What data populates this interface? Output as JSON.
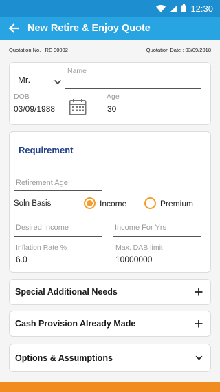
{
  "status": {
    "time": "12:30"
  },
  "appbar": {
    "title": "New Retire & Enjoy Quote"
  },
  "quote": {
    "number_label": "Quotation No. : RE 00002",
    "date_label": "Quotation Date : 03/09/2018"
  },
  "personal": {
    "salutation": "Mr.",
    "name_placeholder": "Name",
    "name_value": "",
    "dob_label": "DOB",
    "dob_value": "03/09/1988",
    "age_label": "Age",
    "age_value": "30"
  },
  "requirement": {
    "title": "Requirement",
    "retirement_age_placeholder": "Retirement Age",
    "soln_basis_label": "Soln Basis",
    "options": [
      {
        "label": "Income",
        "selected": true
      },
      {
        "label": "Premium",
        "selected": false
      }
    ],
    "desired_income_placeholder": "Desired Income",
    "income_for_yrs_placeholder": "Income For Yrs",
    "inflation_label": "Inflation Rate %",
    "inflation_value": "6.0",
    "dab_label": "Max. DAB limit",
    "dab_value": "10000000"
  },
  "sections": [
    {
      "label": "Special Additional Needs",
      "icon": "plus-icon"
    },
    {
      "label": "Cash Provision Already Made",
      "icon": "plus-icon"
    },
    {
      "label": "Options & Assumptions",
      "icon": "chevron-down-icon"
    }
  ],
  "colors": {
    "statusbar": "#1d8fd0",
    "appbar": "#29a4e2",
    "accent": "#f29d2c",
    "heading": "#1f3f86",
    "bottom": "#f08c20"
  }
}
